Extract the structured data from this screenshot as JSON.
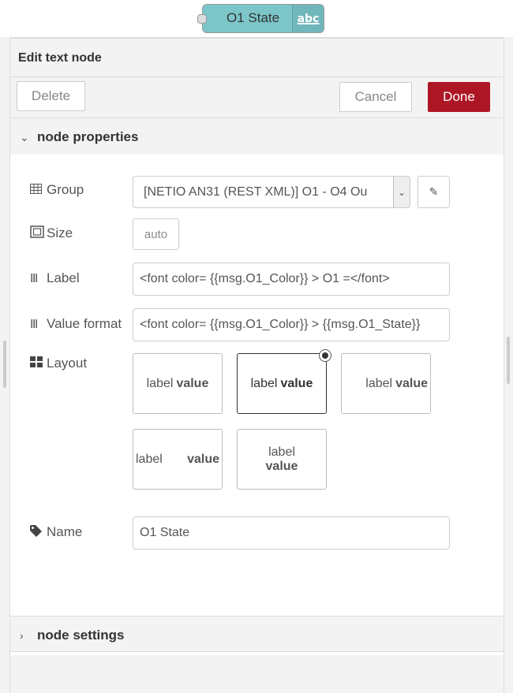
{
  "node": {
    "label": "O1 State",
    "icon": "abc"
  },
  "tray": {
    "title": "Edit text node"
  },
  "toolbar": {
    "delete_label": "Delete",
    "cancel_label": "Cancel",
    "done_label": "Done"
  },
  "sections": {
    "properties": "node properties",
    "settings": "node settings"
  },
  "form": {
    "group": {
      "label": "Group",
      "value": "[NETIO AN31 (REST XML)] O1 - O4 Ou"
    },
    "size": {
      "label": "Size",
      "value": "auto"
    },
    "label": {
      "label": "Label",
      "value": "<font color= {{msg.O1_Color}} > O1 =</font>"
    },
    "value_format": {
      "label": "Value format",
      "value": "<font color= {{msg.O1_Color}} > {{msg.O1_State}}"
    },
    "layout": {
      "label": "Layout",
      "selected": 1,
      "options": [
        {
          "label": "label",
          "value": "value"
        },
        {
          "label": "label",
          "value": "value"
        },
        {
          "label": "label",
          "value": "value"
        },
        {
          "label": "label",
          "value": "value"
        },
        {
          "label": "label",
          "value": "value"
        }
      ]
    },
    "name": {
      "label": "Name",
      "value": "O1 State"
    }
  },
  "colors": {
    "done": "#ad1625",
    "node": "#7cc6ca",
    "panel": "#f3f3f3"
  }
}
